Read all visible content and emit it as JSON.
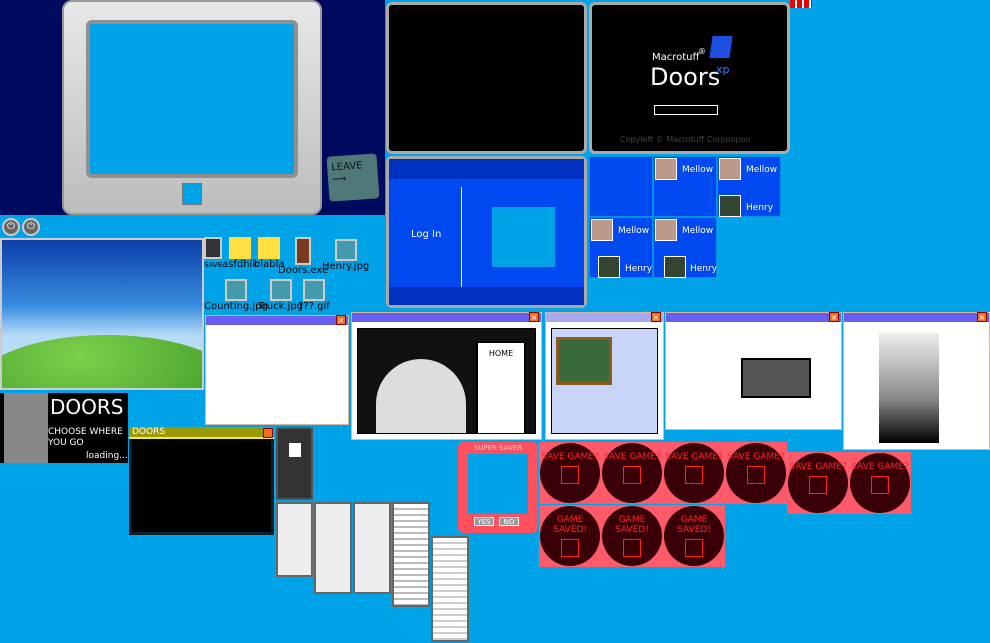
{
  "monitor": {
    "leave_sign": "LEAVE"
  },
  "boot": {
    "brand": "Macrotuff",
    "reg": "®",
    "product": "Doors",
    "edition": "xp",
    "copyright": "Copyleft © Macrotuff Corpoopoo"
  },
  "login": {
    "label": "Log In"
  },
  "users": [
    {
      "row": 0,
      "name": "Mellow"
    },
    {
      "row": 0,
      "name": "Mellow"
    },
    {
      "row": 0,
      "name": "Henry"
    },
    {
      "row": 1,
      "name": "Mellow"
    },
    {
      "row": 1,
      "name": "Mellow"
    },
    {
      "row": 1,
      "name": "Henry"
    },
    {
      "row": 1,
      "name": "Henry"
    }
  ],
  "desktop_icons": [
    {
      "label": "SAVE",
      "icon": "floppy-icon"
    },
    {
      "label": "asfdhik",
      "icon": "folder-icon"
    },
    {
      "label": "blabla",
      "icon": "folder-icon"
    },
    {
      "label": "Doors.exe",
      "icon": "door-icon"
    },
    {
      "label": "Henry.jpg",
      "icon": "image-file-icon"
    },
    {
      "label": "Counting.jpg",
      "icon": "image-file-icon"
    },
    {
      "label": "Truck.jpg",
      "icon": "image-file-icon"
    },
    {
      "label": "???.gif",
      "icon": "image-file-icon"
    }
  ],
  "comic": {
    "home_sign": "HOME"
  },
  "loading_screen": {
    "title": "DOORS",
    "subtitle": "CHOOSE WHERE YOU GO",
    "status": "loading..."
  },
  "doors_window": {
    "title": "DOORS"
  },
  "super_saver": {
    "title": "SUPER-SAVER",
    "yes": "YES",
    "no": "NO"
  },
  "save_prompts": [
    "SAVE GAME?",
    "SAVE GAME?",
    "SAVE GAME?",
    "SAVE GAME?",
    "SAVE GAME?",
    "SAVE GAME?"
  ],
  "saved_msgs": [
    "GAME SAVED!",
    "GAME SAVED!",
    "GAME SAVED!"
  ],
  "colors": {
    "background": "#00a2e8",
    "login_blue": "#0048f0",
    "save_red": "#ff2020",
    "window_title": "#6a5ef0"
  }
}
